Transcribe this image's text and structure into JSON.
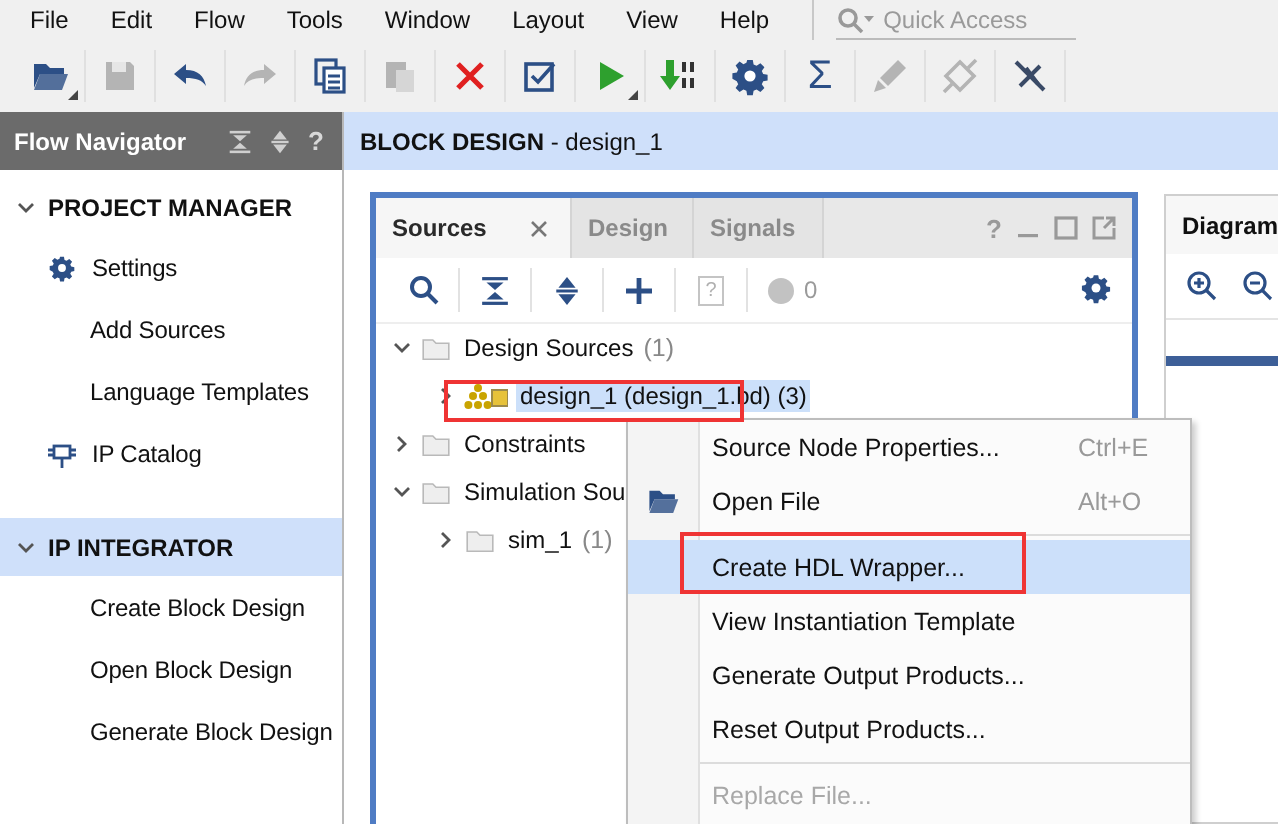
{
  "menu_bar": [
    "File",
    "Edit",
    "Flow",
    "Tools",
    "Window",
    "Layout",
    "View",
    "Help"
  ],
  "quick_access": {
    "placeholder": "Quick Access"
  },
  "toolbar": [
    {
      "kind": "open",
      "disabled": false,
      "has_menu": true
    },
    {
      "kind": "save",
      "disabled": true
    },
    {
      "kind": "undo",
      "disabled": false
    },
    {
      "kind": "redo",
      "disabled": true
    },
    {
      "kind": "copy",
      "disabled": false
    },
    {
      "kind": "paste",
      "disabled": true
    },
    {
      "kind": "delete",
      "disabled": false
    },
    {
      "kind": "check",
      "disabled": false
    },
    {
      "kind": "run",
      "disabled": false,
      "has_menu": true
    },
    {
      "kind": "program",
      "disabled": false
    },
    {
      "kind": "settings",
      "disabled": false
    },
    {
      "kind": "symbol",
      "label": "Σ",
      "disabled": false
    },
    {
      "kind": "pen",
      "disabled": true
    },
    {
      "kind": "probe",
      "disabled": true
    },
    {
      "kind": "unplug",
      "disabled": false
    }
  ],
  "flow_navigator": {
    "title": "Flow Navigator",
    "help": "?",
    "sections": [
      {
        "label": "PROJECT MANAGER",
        "expanded": true,
        "selected": false,
        "items": [
          {
            "label": "Settings",
            "kind": "settings"
          },
          {
            "label": "Add Sources",
            "kind": "link"
          },
          {
            "label": "Language Templates",
            "kind": "link"
          },
          {
            "label": "IP Catalog",
            "kind": "catalog"
          }
        ]
      },
      {
        "label": "IP INTEGRATOR",
        "expanded": true,
        "selected": true,
        "items": [
          {
            "label": "Create Block Design",
            "kind": "link"
          },
          {
            "label": "Open Block Design",
            "kind": "link"
          },
          {
            "label": "Generate Block Design",
            "kind": "link"
          }
        ]
      }
    ]
  },
  "editor": {
    "title": "**BLOCK DESIGN** - design_1"
  },
  "sources_panel": {
    "tabs": [
      {
        "label": "Sources",
        "selected": true,
        "closable": true
      },
      {
        "label": "Design",
        "selected": false
      },
      {
        "label": "Signals",
        "selected": false
      }
    ],
    "help": "?",
    "help_button": "?",
    "issue_count": "0",
    "tree": [
      {
        "label": "Design Sources",
        "count": "(1)",
        "kind": "folder",
        "expanded": true,
        "selected": false,
        "children": [
          {
            "label": "design_1 (design_1.bd) (3)",
            "kind": "block_design",
            "expanded": false,
            "selected": true
          }
        ]
      },
      {
        "label": "Constraints",
        "kind": "folder",
        "expanded": false,
        "selected": false
      },
      {
        "label": "Simulation Sou",
        "kind": "folder",
        "expanded": true,
        "selected": false,
        "children": [
          {
            "label": "sim_1",
            "count": "(1)",
            "kind": "folder",
            "expanded": false,
            "selected": false
          }
        ]
      }
    ]
  },
  "diagram_panel": {
    "tab": "Diagram"
  },
  "context_menu": [
    {
      "kind": "command",
      "label": "Source Node Properties...",
      "shortcut": "Ctrl+E",
      "selected": false,
      "disabled": false
    },
    {
      "kind": "open_command",
      "label": "Open File",
      "shortcut": "Alt+O",
      "selected": false,
      "disabled": false
    },
    {
      "kind": "separator"
    },
    {
      "kind": "command",
      "label": "Create HDL Wrapper...",
      "selected": true,
      "disabled": false
    },
    {
      "kind": "command",
      "label": "View Instantiation Template",
      "selected": false,
      "disabled": false
    },
    {
      "kind": "command",
      "label": "Generate Output Products...",
      "selected": false,
      "disabled": false
    },
    {
      "kind": "command",
      "label": "Reset Output Products...",
      "selected": false,
      "disabled": false
    },
    {
      "kind": "separator"
    },
    {
      "kind": "command",
      "label": "Replace File...",
      "selected": false,
      "disabled": true
    }
  ]
}
